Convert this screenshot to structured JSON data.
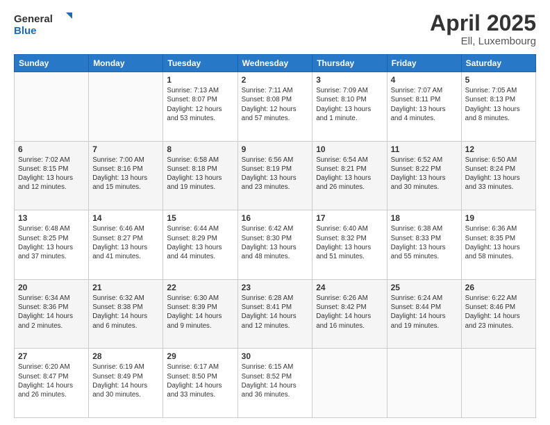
{
  "logo": {
    "line1": "General",
    "line2": "Blue"
  },
  "title": "April 2025",
  "location": "Ell, Luxembourg",
  "days_header": [
    "Sunday",
    "Monday",
    "Tuesday",
    "Wednesday",
    "Thursday",
    "Friday",
    "Saturday"
  ],
  "weeks": [
    [
      {
        "day": "",
        "sunrise": "",
        "sunset": "",
        "daylight": ""
      },
      {
        "day": "",
        "sunrise": "",
        "sunset": "",
        "daylight": ""
      },
      {
        "day": "1",
        "sunrise": "Sunrise: 7:13 AM",
        "sunset": "Sunset: 8:07 PM",
        "daylight": "Daylight: 12 hours and 53 minutes."
      },
      {
        "day": "2",
        "sunrise": "Sunrise: 7:11 AM",
        "sunset": "Sunset: 8:08 PM",
        "daylight": "Daylight: 12 hours and 57 minutes."
      },
      {
        "day": "3",
        "sunrise": "Sunrise: 7:09 AM",
        "sunset": "Sunset: 8:10 PM",
        "daylight": "Daylight: 13 hours and 1 minute."
      },
      {
        "day": "4",
        "sunrise": "Sunrise: 7:07 AM",
        "sunset": "Sunset: 8:11 PM",
        "daylight": "Daylight: 13 hours and 4 minutes."
      },
      {
        "day": "5",
        "sunrise": "Sunrise: 7:05 AM",
        "sunset": "Sunset: 8:13 PM",
        "daylight": "Daylight: 13 hours and 8 minutes."
      }
    ],
    [
      {
        "day": "6",
        "sunrise": "Sunrise: 7:02 AM",
        "sunset": "Sunset: 8:15 PM",
        "daylight": "Daylight: 13 hours and 12 minutes."
      },
      {
        "day": "7",
        "sunrise": "Sunrise: 7:00 AM",
        "sunset": "Sunset: 8:16 PM",
        "daylight": "Daylight: 13 hours and 15 minutes."
      },
      {
        "day": "8",
        "sunrise": "Sunrise: 6:58 AM",
        "sunset": "Sunset: 8:18 PM",
        "daylight": "Daylight: 13 hours and 19 minutes."
      },
      {
        "day": "9",
        "sunrise": "Sunrise: 6:56 AM",
        "sunset": "Sunset: 8:19 PM",
        "daylight": "Daylight: 13 hours and 23 minutes."
      },
      {
        "day": "10",
        "sunrise": "Sunrise: 6:54 AM",
        "sunset": "Sunset: 8:21 PM",
        "daylight": "Daylight: 13 hours and 26 minutes."
      },
      {
        "day": "11",
        "sunrise": "Sunrise: 6:52 AM",
        "sunset": "Sunset: 8:22 PM",
        "daylight": "Daylight: 13 hours and 30 minutes."
      },
      {
        "day": "12",
        "sunrise": "Sunrise: 6:50 AM",
        "sunset": "Sunset: 8:24 PM",
        "daylight": "Daylight: 13 hours and 33 minutes."
      }
    ],
    [
      {
        "day": "13",
        "sunrise": "Sunrise: 6:48 AM",
        "sunset": "Sunset: 8:25 PM",
        "daylight": "Daylight: 13 hours and 37 minutes."
      },
      {
        "day": "14",
        "sunrise": "Sunrise: 6:46 AM",
        "sunset": "Sunset: 8:27 PM",
        "daylight": "Daylight: 13 hours and 41 minutes."
      },
      {
        "day": "15",
        "sunrise": "Sunrise: 6:44 AM",
        "sunset": "Sunset: 8:29 PM",
        "daylight": "Daylight: 13 hours and 44 minutes."
      },
      {
        "day": "16",
        "sunrise": "Sunrise: 6:42 AM",
        "sunset": "Sunset: 8:30 PM",
        "daylight": "Daylight: 13 hours and 48 minutes."
      },
      {
        "day": "17",
        "sunrise": "Sunrise: 6:40 AM",
        "sunset": "Sunset: 8:32 PM",
        "daylight": "Daylight: 13 hours and 51 minutes."
      },
      {
        "day": "18",
        "sunrise": "Sunrise: 6:38 AM",
        "sunset": "Sunset: 8:33 PM",
        "daylight": "Daylight: 13 hours and 55 minutes."
      },
      {
        "day": "19",
        "sunrise": "Sunrise: 6:36 AM",
        "sunset": "Sunset: 8:35 PM",
        "daylight": "Daylight: 13 hours and 58 minutes."
      }
    ],
    [
      {
        "day": "20",
        "sunrise": "Sunrise: 6:34 AM",
        "sunset": "Sunset: 8:36 PM",
        "daylight": "Daylight: 14 hours and 2 minutes."
      },
      {
        "day": "21",
        "sunrise": "Sunrise: 6:32 AM",
        "sunset": "Sunset: 8:38 PM",
        "daylight": "Daylight: 14 hours and 6 minutes."
      },
      {
        "day": "22",
        "sunrise": "Sunrise: 6:30 AM",
        "sunset": "Sunset: 8:39 PM",
        "daylight": "Daylight: 14 hours and 9 minutes."
      },
      {
        "day": "23",
        "sunrise": "Sunrise: 6:28 AM",
        "sunset": "Sunset: 8:41 PM",
        "daylight": "Daylight: 14 hours and 12 minutes."
      },
      {
        "day": "24",
        "sunrise": "Sunrise: 6:26 AM",
        "sunset": "Sunset: 8:42 PM",
        "daylight": "Daylight: 14 hours and 16 minutes."
      },
      {
        "day": "25",
        "sunrise": "Sunrise: 6:24 AM",
        "sunset": "Sunset: 8:44 PM",
        "daylight": "Daylight: 14 hours and 19 minutes."
      },
      {
        "day": "26",
        "sunrise": "Sunrise: 6:22 AM",
        "sunset": "Sunset: 8:46 PM",
        "daylight": "Daylight: 14 hours and 23 minutes."
      }
    ],
    [
      {
        "day": "27",
        "sunrise": "Sunrise: 6:20 AM",
        "sunset": "Sunset: 8:47 PM",
        "daylight": "Daylight: 14 hours and 26 minutes."
      },
      {
        "day": "28",
        "sunrise": "Sunrise: 6:19 AM",
        "sunset": "Sunset: 8:49 PM",
        "daylight": "Daylight: 14 hours and 30 minutes."
      },
      {
        "day": "29",
        "sunrise": "Sunrise: 6:17 AM",
        "sunset": "Sunset: 8:50 PM",
        "daylight": "Daylight: 14 hours and 33 minutes."
      },
      {
        "day": "30",
        "sunrise": "Sunrise: 6:15 AM",
        "sunset": "Sunset: 8:52 PM",
        "daylight": "Daylight: 14 hours and 36 minutes."
      },
      {
        "day": "",
        "sunrise": "",
        "sunset": "",
        "daylight": ""
      },
      {
        "day": "",
        "sunrise": "",
        "sunset": "",
        "daylight": ""
      },
      {
        "day": "",
        "sunrise": "",
        "sunset": "",
        "daylight": ""
      }
    ]
  ]
}
